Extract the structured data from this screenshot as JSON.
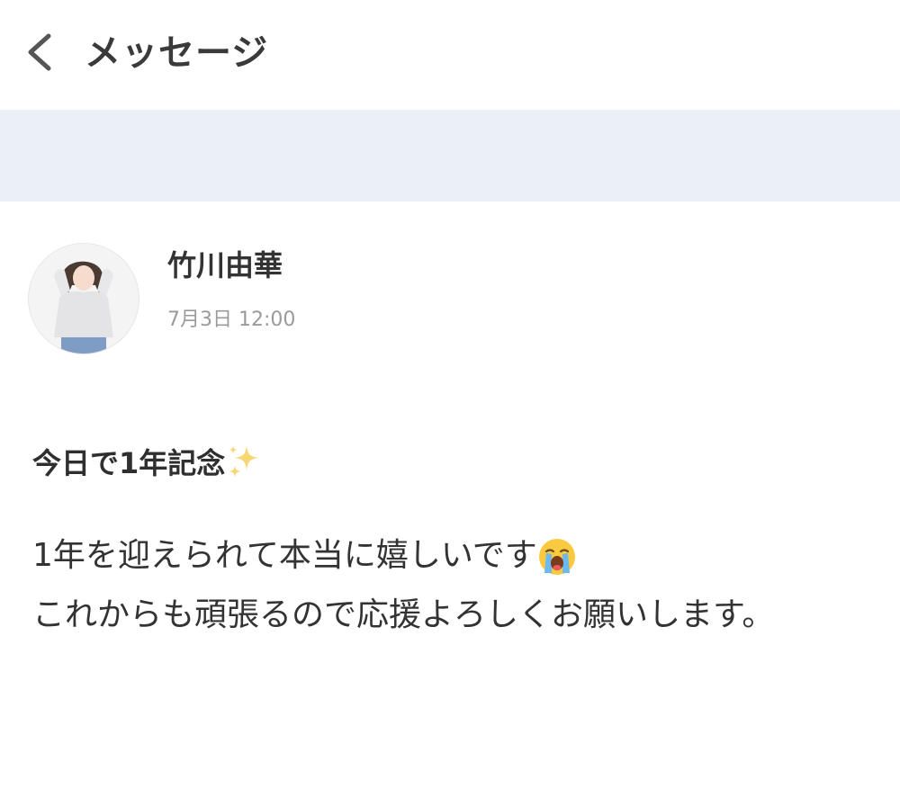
{
  "header": {
    "title": "メッセージ",
    "back_icon": "chevron-left-icon"
  },
  "post": {
    "sender_name": "竹川由華",
    "timestamp": "7月3日 12:00",
    "heading_text": "今日で1年記念",
    "heading_emoji": "sparkles-icon",
    "body_line_1": "1年を迎えられて本当に嬉しいです",
    "body_emoji": "loudly-crying-face-icon",
    "body_line_2": "これからも頑張るので応援よろしくお願いします。"
  },
  "colors": {
    "banner_strip": "#ebeff7",
    "timestamp": "#9a9a9a",
    "text": "#333333"
  }
}
